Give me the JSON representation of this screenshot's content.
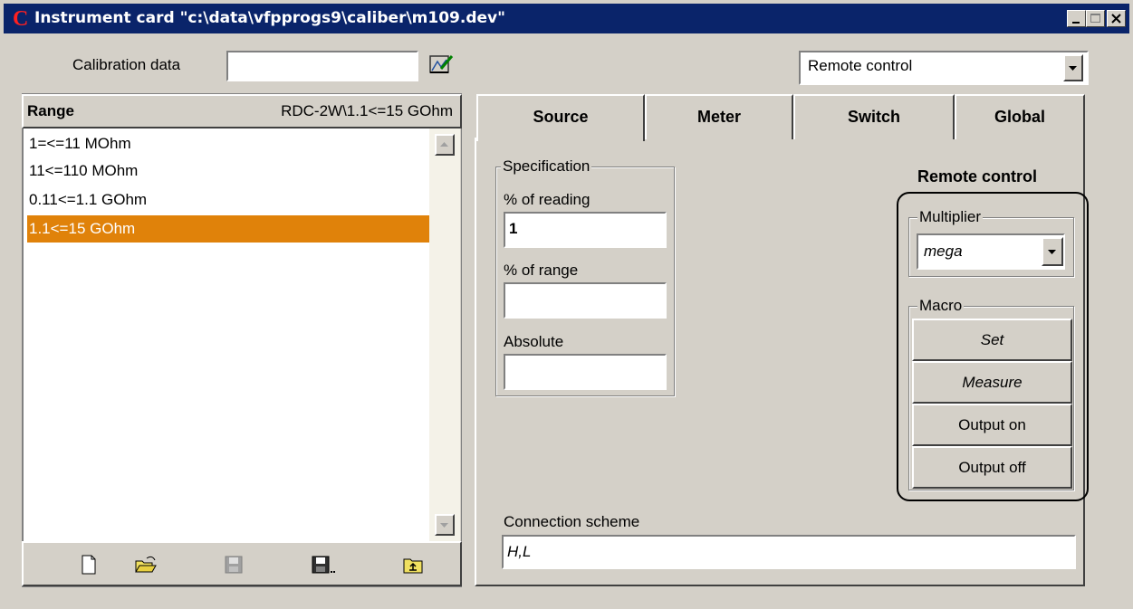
{
  "window": {
    "title": "Instrument card \"c:\\data\\vfpprogs9\\caliber\\m109.dev\""
  },
  "calibration": {
    "label": "Calibration data",
    "value": ""
  },
  "mode_select": {
    "value": "Remote control"
  },
  "range": {
    "header": "Range",
    "current": "RDC-2W\\1.1<=15 GOhm",
    "items": [
      "1=<=11 MOhm",
      "11<=110 MOhm",
      "0.11<=1.1 GOhm",
      "1.1<=15 GOhm"
    ],
    "selected_index": 3
  },
  "toolbar_icons": [
    "new-file-icon",
    "open-folder-icon",
    "save-disabled-icon",
    "save-as-icon",
    "export-icon"
  ],
  "tabs": [
    "Source",
    "Meter",
    "Switch",
    "Global"
  ],
  "active_tab": "Source",
  "specification": {
    "legend": "Specification",
    "reading_label": "% of reading",
    "reading_value": "1",
    "range_label": "% of range",
    "range_value": "",
    "absolute_label": "Absolute",
    "absolute_value": ""
  },
  "remote": {
    "title": "Remote control",
    "multiplier_legend": "Multiplier",
    "multiplier_value": "mega",
    "macro_legend": "Macro",
    "macro_buttons": [
      "Set",
      "Measure",
      "Output on",
      "Output off"
    ]
  },
  "connection": {
    "label": "Connection scheme",
    "value": "H,L"
  },
  "colors": {
    "titlebar": "#0a246a",
    "selection": "#e0820a",
    "face": "#d4d0c8"
  }
}
